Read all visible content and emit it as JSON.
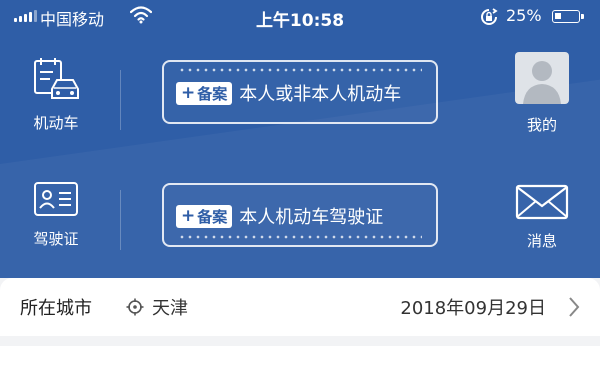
{
  "status_bar": {
    "carrier": "中国移动",
    "time": "上午10:58",
    "battery": "25%",
    "battery_level": 0.25
  },
  "actions": {
    "vehicle_label": "机动车",
    "license_label": "驾驶证",
    "mine_label": "我的",
    "message_label": "消息"
  },
  "cards": [
    {
      "badge": "备案",
      "text": "本人或非本人机动车"
    },
    {
      "badge": "备案",
      "text": "本人机动车驾驶证"
    }
  ],
  "city_row": {
    "label": "所在城市",
    "city": "天津",
    "date": "2018年09月29日"
  },
  "colors": {
    "brand_blue": "#2f5ea7",
    "avatar_bg": "#dfe3e8"
  },
  "icons": [
    "signal-icon",
    "wifi-icon",
    "rotation-lock-icon",
    "battery-icon",
    "vehicle-icon",
    "license-icon",
    "avatar-icon",
    "mail-icon",
    "location-icon",
    "chevron-right-icon"
  ]
}
